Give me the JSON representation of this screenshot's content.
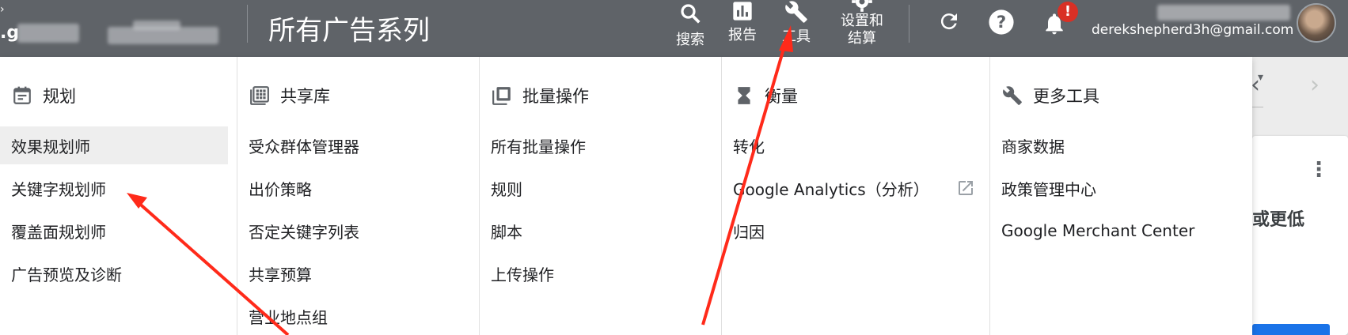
{
  "topbar": {
    "account_prefix": ".g",
    "title": "所有广告系列",
    "actions": [
      {
        "label": "搜索",
        "icon": "search-icon"
      },
      {
        "label": "报告",
        "icon": "report-icon"
      },
      {
        "label": "工具",
        "icon": "wrench-icon"
      },
      {
        "label": "设置和\n结算",
        "icon": "gear-icon"
      }
    ],
    "refresh_icon": "refresh-icon",
    "help_icon": "help-icon",
    "notifications_badge": "!",
    "email": "derekshepherd3h@gmail.com"
  },
  "background": {
    "partial_text": "或更低"
  },
  "menu": {
    "columns": [
      {
        "heading": "规划",
        "icon": "calendar-icon",
        "items": [
          "效果规划师",
          "关键字规划师",
          "覆盖面规划师",
          "广告预览及诊断"
        ]
      },
      {
        "heading": "共享库",
        "icon": "library-icon",
        "items": [
          "受众群体管理器",
          "出价策略",
          "否定关键字列表",
          "共享预算",
          "营业地点组"
        ]
      },
      {
        "heading": "批量操作",
        "icon": "bulk-actions-icon",
        "items": [
          "所有批量操作",
          "规则",
          "脚本",
          "上传操作"
        ]
      },
      {
        "heading": "衡量",
        "icon": "hourglass-icon",
        "items": [
          "转化",
          "Google Analytics（分析）",
          "归因"
        ]
      },
      {
        "heading": "更多工具",
        "icon": "wrench-icon",
        "items": [
          "商家数据",
          "政策管理中心",
          "Google Merchant Center"
        ]
      }
    ]
  },
  "colors": {
    "topbar_bg": "#5f6368",
    "menu_bg": "#ffffff",
    "active_item_bg": "#eeeeee",
    "badge": "#d93025",
    "annotation_arrow": "#ff2a1a"
  }
}
